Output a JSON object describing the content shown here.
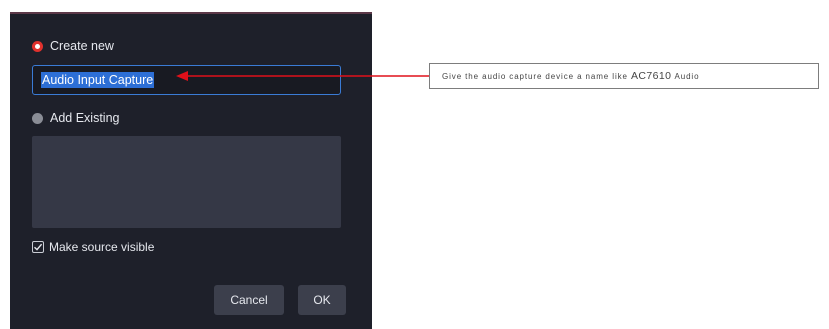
{
  "dialog": {
    "create_new_label": "Create new",
    "name_input_value": "Audio Input Capture",
    "add_existing_label": "Add Existing",
    "make_visible_label": "Make source visible",
    "make_visible_checked": true,
    "cancel_label": "Cancel",
    "ok_label": "OK"
  },
  "annotation": {
    "text_small": "Give the audio capture device a name like",
    "text_large": "AC7610",
    "text_small_end": "Audio",
    "arrow_color": "#e0101a"
  },
  "colors": {
    "dialog_bg": "#1e202a",
    "accent_blue": "#3a7bd5",
    "radio_active": "#e0312d"
  }
}
